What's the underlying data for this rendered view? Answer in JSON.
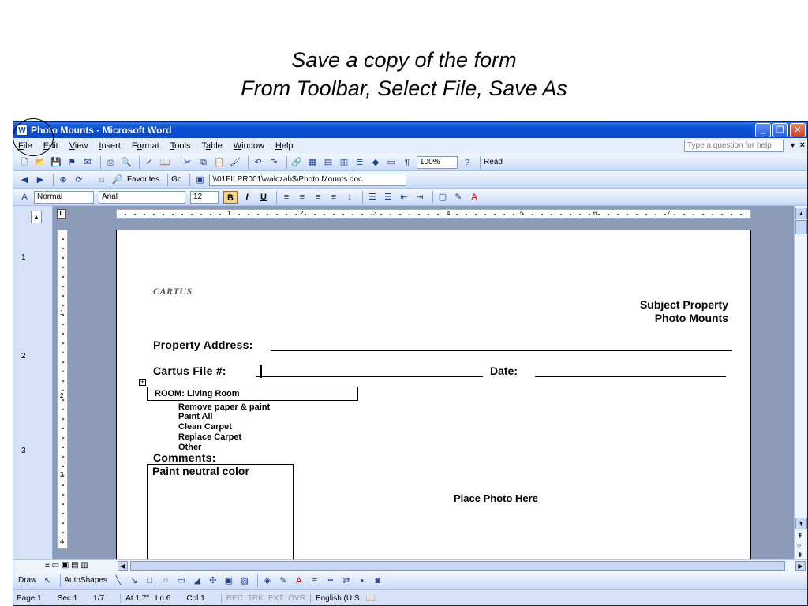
{
  "slide": {
    "title_line1": "Save a copy of the form",
    "title_line2": "From Toolbar, Select File, Save As"
  },
  "window": {
    "title": "Photo Mounts - Microsoft Word",
    "minimize_label": "_",
    "restore_label": "❐",
    "close_label": "✕"
  },
  "menu": {
    "items": [
      {
        "accel": "F",
        "rest": "ile"
      },
      {
        "accel": "E",
        "rest": "dit"
      },
      {
        "accel": "V",
        "rest": "iew"
      },
      {
        "accel": "I",
        "rest": "nsert"
      },
      {
        "pre": "F",
        "accel": "o",
        "rest": "rmat"
      },
      {
        "accel": "T",
        "rest": "ools"
      },
      {
        "pre": "T",
        "accel": "a",
        "rest": "ble"
      },
      {
        "accel": "W",
        "rest": "indow"
      },
      {
        "accel": "H",
        "rest": "elp"
      }
    ],
    "help_placeholder": "Type a question for help",
    "close_label": "×"
  },
  "standard_toolbar": {
    "zoom": "100%",
    "read_label": "Read"
  },
  "web_toolbar": {
    "favorites_label": "Favorites",
    "go_label": "Go",
    "address": "\\\\01FILPR001\\walczah$\\Photo Mounts.doc"
  },
  "formatting_toolbar": {
    "style": "Normal",
    "font": "Arial",
    "size": "12",
    "bold": "B",
    "italic": "I",
    "underline": "U"
  },
  "ruler": {
    "numbers": [
      "1",
      "2",
      "3",
      "4",
      "5",
      "6",
      "7"
    ],
    "vertical_numbers": [
      "1",
      "2",
      "3",
      "4"
    ]
  },
  "left_strip": {
    "page_labels": [
      "1",
      "2",
      "3"
    ]
  },
  "document": {
    "company": "CARTUS",
    "subject_line1": "Subject Property",
    "subject_line2": "Photo Mounts",
    "property_address_label": "Property Address:",
    "file_label": "Cartus  File #:",
    "date_label": "Date:",
    "room_label": "ROOM: Living Room",
    "tasks": [
      "Remove paper & paint",
      "Paint All",
      "Clean Carpet",
      "Replace Carpet",
      "Other"
    ],
    "comments_label": "Comments:",
    "comments_value": "Paint neutral color",
    "photo_placeholder": "Place Photo Here"
  },
  "drawing_toolbar": {
    "draw_label": "Draw",
    "autoshapes_label": "AutoShapes"
  },
  "status": {
    "page": "Page 1",
    "section": "Sec 1",
    "pages": "1/7",
    "at": "At 1.7\"",
    "line": "Ln 6",
    "col": "Col 1",
    "rec": "REC",
    "trk": "TRK",
    "ext": "EXT",
    "ovr": "OVR",
    "language": "English (U.S"
  },
  "colors": {
    "titlebar": "#0b49c6",
    "toolbar": "#c9daf6",
    "workspace": "#8c9cb8",
    "highlight": "#fbd68a"
  }
}
